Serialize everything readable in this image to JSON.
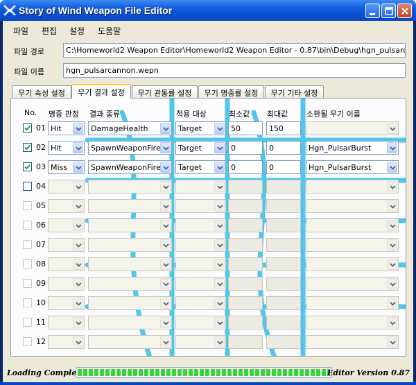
{
  "window": {
    "title": "Story of Wind Weapon File Editor"
  },
  "menu": {
    "items": [
      "파일",
      "편집",
      "설정",
      "도움말"
    ]
  },
  "file": {
    "path_label": "파일 경로",
    "path_value": "C:\\Homeworld2 Weapon Editor\\Homeworld2 Weapon Editor - 0.87\\bin\\Debug\\hgn_pulsarc",
    "name_label": "파일 이름",
    "name_value": "hgn_pulsarcannon.wepn"
  },
  "tabs": [
    {
      "label": "무기 속성 설정",
      "active": false
    },
    {
      "label": "무기 결과 설정",
      "active": true
    },
    {
      "label": "무기 관통률 설정",
      "active": false
    },
    {
      "label": "무기 명중률 설정",
      "active": false
    },
    {
      "label": "무기 기타 설정",
      "active": false
    }
  ],
  "table": {
    "headers": {
      "no": "No.",
      "hit": "명중 판정",
      "result": "결과 종류",
      "target": "적용 대상",
      "min": "최소값",
      "max": "최대값",
      "spawn": "소환될 무기 이름"
    },
    "rows": [
      {
        "num": "01",
        "checked": true,
        "hit": "Hit",
        "result": "DamageHealth",
        "target": "Target",
        "min": "50",
        "max": "150",
        "spawn": "",
        "enabled": true
      },
      {
        "num": "02",
        "checked": true,
        "hit": "Hit",
        "result": "SpawnWeaponFire",
        "target": "Target",
        "min": "0",
        "max": "0",
        "spawn": "Hgn_PulsarBurst",
        "enabled": true
      },
      {
        "num": "03",
        "checked": true,
        "hit": "Miss",
        "result": "SpawnWeaponFire",
        "target": "Target",
        "min": "0",
        "max": "0",
        "spawn": "Hgn_PulsarBurst",
        "enabled": true
      },
      {
        "num": "04",
        "checked": false,
        "hit": "",
        "result": "",
        "target": "",
        "min": "",
        "max": "",
        "spawn": "",
        "enabled": false
      },
      {
        "num": "05",
        "checked": false,
        "hit": "",
        "result": "",
        "target": "",
        "min": "",
        "max": "",
        "spawn": "",
        "enabled": false
      },
      {
        "num": "06",
        "checked": false,
        "hit": "",
        "result": "",
        "target": "",
        "min": "",
        "max": "",
        "spawn": "",
        "enabled": false
      },
      {
        "num": "07",
        "checked": false,
        "hit": "",
        "result": "",
        "target": "",
        "min": "",
        "max": "",
        "spawn": "",
        "enabled": false
      },
      {
        "num": "08",
        "checked": false,
        "hit": "",
        "result": "",
        "target": "",
        "min": "",
        "max": "",
        "spawn": "",
        "enabled": false
      },
      {
        "num": "09",
        "checked": false,
        "hit": "",
        "result": "",
        "target": "",
        "min": "",
        "max": "",
        "spawn": "",
        "enabled": false
      },
      {
        "num": "10",
        "checked": false,
        "hit": "",
        "result": "",
        "target": "",
        "min": "",
        "max": "",
        "spawn": "",
        "enabled": false
      },
      {
        "num": "11",
        "checked": false,
        "hit": "",
        "result": "",
        "target": "",
        "min": "",
        "max": "",
        "spawn": "",
        "enabled": false
      },
      {
        "num": "12",
        "checked": false,
        "hit": "",
        "result": "",
        "target": "",
        "min": "",
        "max": "",
        "spawn": "",
        "enabled": false
      }
    ]
  },
  "status": {
    "left_text": "Loading Complete",
    "progress_fraction": 1.0,
    "right_text": "Editor Version 0.87"
  },
  "colors": {
    "title_bar": "#0a52d6",
    "watermark": "#19b4e6",
    "progress": "#37d537",
    "dialog_bg": "#ece9d8"
  },
  "icons": {
    "app": "wind-logo-icon",
    "minimize": "minimize-icon",
    "maximize": "maximize-icon",
    "close": "close-icon",
    "check": "check-icon",
    "dropdown": "chevron-down-icon"
  }
}
